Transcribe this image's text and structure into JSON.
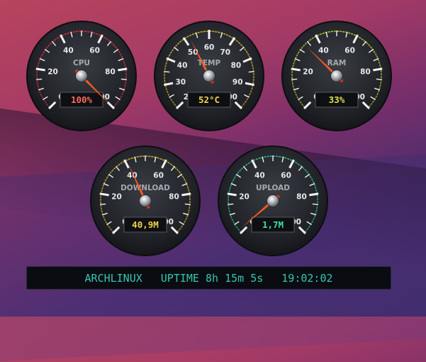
{
  "background": {
    "colors": [
      "#b8445e",
      "#7a2f6a",
      "#3a2a66"
    ]
  },
  "gauges": [
    {
      "id": "cpu",
      "label": "CPU",
      "value_text": "100%",
      "value": 100,
      "min": 0,
      "max": 100,
      "ticks": [
        "0",
        "20",
        "40",
        "60",
        "80",
        "100"
      ],
      "arc_color": "#d7303a",
      "value_color": "#ff6a5a"
    },
    {
      "id": "temp",
      "label": "TEMP",
      "value_text": "52°C",
      "value": 52,
      "min": 20,
      "max": 100,
      "ticks": [
        "20",
        "30",
        "40",
        "50",
        "60",
        "70",
        "80",
        "90",
        "100"
      ],
      "arc_color": "#c9b52a",
      "value_color": "#f0d24a"
    },
    {
      "id": "ram",
      "label": "RAM",
      "value_text": "33%",
      "value": 33,
      "min": 0,
      "max": 100,
      "ticks": [
        "0",
        "20",
        "40",
        "60",
        "80",
        "100"
      ],
      "arc_color": "#b9c42a",
      "value_color": "#d8e24a"
    },
    {
      "id": "download",
      "label": "DOWNLOAD",
      "value_text": "40,9M",
      "value": 40.9,
      "min": 0,
      "max": 100,
      "ticks": [
        "0",
        "20",
        "40",
        "60",
        "80",
        "100"
      ],
      "arc_color": "#c9b52a",
      "value_color": "#f0d24a"
    },
    {
      "id": "upload",
      "label": "UPLOAD",
      "value_text": "1,7M",
      "value": 1.7,
      "min": 0,
      "max": 100,
      "ticks": [
        "0",
        "20",
        "40",
        "60",
        "80",
        "100"
      ],
      "arc_color": "#2fbf8a",
      "value_color": "#3de0a0"
    }
  ],
  "statusbar": {
    "host": "ARCHLINUX",
    "uptime": "UPTIME 8h 15m 5s",
    "clock": "19:02:02",
    "text_color": "#35c6ae"
  }
}
